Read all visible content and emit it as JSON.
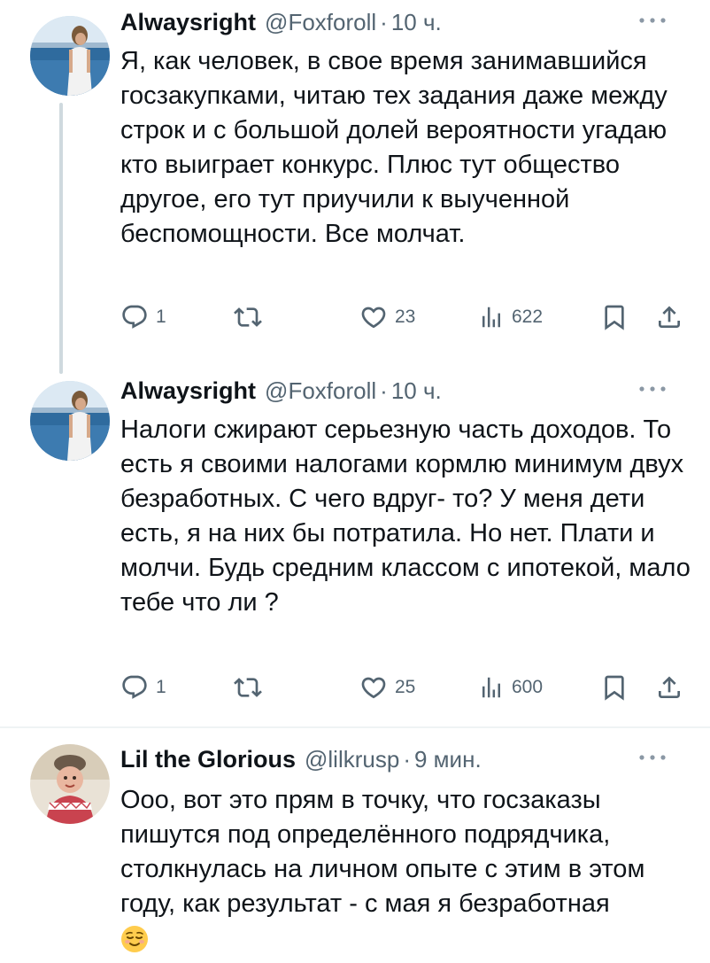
{
  "tweets": [
    {
      "name": "Alwaysright",
      "handle": "@Foxforoll",
      "sep": "·",
      "time": "10 ч.",
      "text": "Я, как человек, в свое время занимавшийся госзакупками, читаю тех задания даже между строк и с большой долей вероятности угадаю кто выиграет конкурс. Плюс тут общество другое, его тут приучили к выученной беспомощности. Все молчат.",
      "replies": "1",
      "retweets": "",
      "likes": "23",
      "views": "622"
    },
    {
      "name": "Alwaysright",
      "handle": "@Foxforoll",
      "sep": "·",
      "time": "10 ч.",
      "text": "Налоги сжирают серьезную часть доходов. То есть я своими налогами кормлю минимум двух безработных. С чего вдруг- то? У меня дети есть, я на них бы потратила. Но нет. Плати и молчи. Будь средним классом с ипотекой, мало тебе что ли ?",
      "replies": "1",
      "retweets": "",
      "likes": "25",
      "views": "600"
    },
    {
      "name": "Lil the Glorious",
      "handle": "@lilkrusp",
      "sep": "·",
      "time": "9 мин.",
      "text": "Ооо, вот это прям в точку, что госзаказы пишутся под определённого подрядчика, столкнулась на личном опыте с этим в этом году, как результат - с мая я безработная",
      "emoji": "relieved-face"
    }
  ],
  "icons": {
    "reply": "reply-icon",
    "retweet": "retweet-icon",
    "like": "heart-icon",
    "views": "views-icon",
    "bookmark": "bookmark-icon",
    "share": "share-icon",
    "more": "more-dots-icon"
  },
  "colors": {
    "text": "#0f1419",
    "secondary": "#536471",
    "divider": "#eff3f4",
    "thread": "#cfd9de"
  }
}
